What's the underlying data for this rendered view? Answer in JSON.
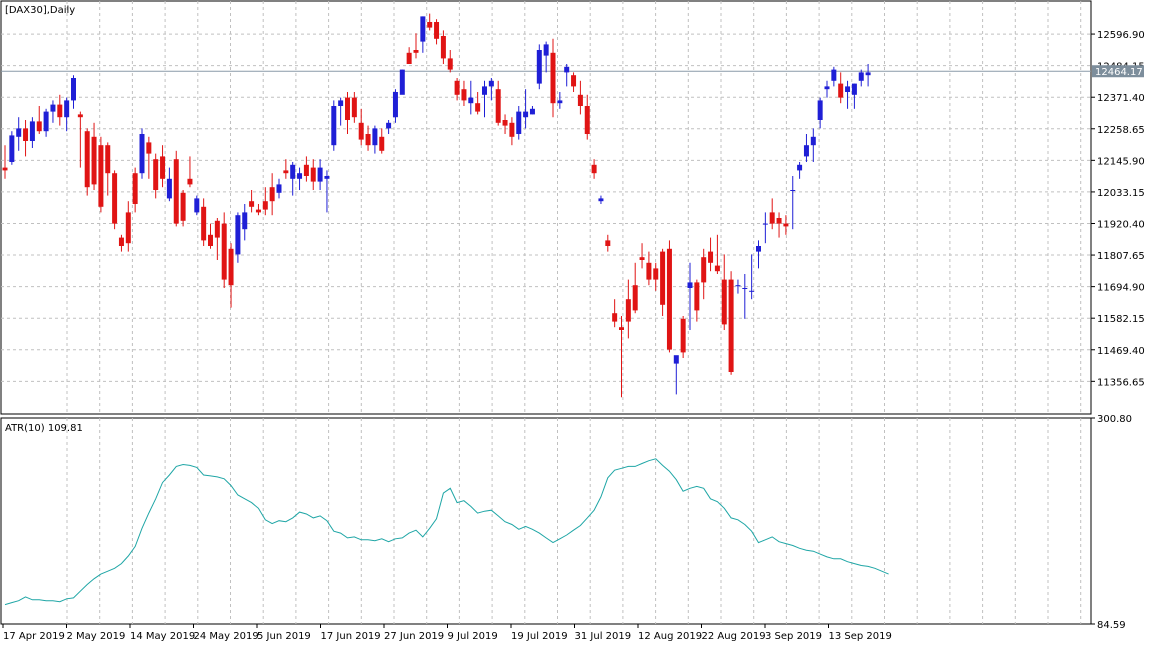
{
  "chart_data": [
    {
      "type": "candlestick",
      "title": "[DAX30],Daily",
      "up_color": "#1f1fd6",
      "down_color": "#e01414",
      "ylim": [
        11240,
        12715
      ],
      "y_ticks": [
        "12596.90",
        "12371.40",
        "12258.65",
        "12145.90",
        "12033.15",
        "11920.40",
        "11807.65",
        "11694.90",
        "11582.15",
        "11469.40",
        "11356.65"
      ],
      "partial_tick": "12484.15",
      "current_price": "12464.17",
      "current_price_value": 12464.17,
      "candles": [
        [
          12120,
          12200,
          12080,
          12110
        ],
        [
          12140,
          12250,
          12130,
          12235
        ],
        [
          12230,
          12300,
          12180,
          12260
        ],
        [
          12260,
          12290,
          12160,
          12215
        ],
        [
          12215,
          12300,
          12190,
          12285
        ],
        [
          12285,
          12340,
          12240,
          12250
        ],
        [
          12250,
          12330,
          12230,
          12320
        ],
        [
          12320,
          12360,
          12280,
          12345
        ],
        [
          12345,
          12380,
          12270,
          12300
        ],
        [
          12300,
          12370,
          12250,
          12360
        ],
        [
          12360,
          12450,
          12330,
          12440
        ],
        [
          12310,
          12320,
          12120,
          12300
        ],
        [
          12250,
          12260,
          12020,
          12050
        ],
        [
          12230,
          12280,
          12040,
          12060
        ],
        [
          12200,
          12230,
          11960,
          11980
        ],
        [
          12200,
          12210,
          12020,
          12100
        ],
        [
          12100,
          12110,
          11900,
          11920
        ],
        [
          11870,
          11880,
          11820,
          11840
        ],
        [
          11960,
          12000,
          11820,
          11850
        ],
        [
          12100,
          12120,
          11960,
          11990
        ],
        [
          12100,
          12260,
          12080,
          12240
        ],
        [
          12210,
          12230,
          12080,
          12170
        ],
        [
          12150,
          12170,
          12010,
          12040
        ],
        [
          12160,
          12200,
          12050,
          12080
        ],
        [
          12010,
          12120,
          12000,
          12080
        ],
        [
          12150,
          12180,
          11910,
          11920
        ],
        [
          12030,
          12040,
          11910,
          11930
        ],
        [
          12080,
          12160,
          12050,
          12060
        ],
        [
          11960,
          12020,
          11950,
          12010
        ],
        [
          11980,
          12010,
          11840,
          11860
        ],
        [
          11880,
          11920,
          11830,
          11840
        ],
        [
          11930,
          11940,
          11790,
          11870
        ],
        [
          11920,
          11960,
          11690,
          11720
        ],
        [
          11830,
          11850,
          11620,
          11700
        ],
        [
          11810,
          11960,
          11780,
          11950
        ],
        [
          11900,
          11990,
          11860,
          11960
        ],
        [
          12000,
          12040,
          11960,
          11980
        ],
        [
          11970,
          11990,
          11950,
          11960
        ],
        [
          12000,
          12050,
          11950,
          11970
        ],
        [
          12050,
          12100,
          11950,
          12000
        ],
        [
          12030,
          12080,
          12010,
          12060
        ],
        [
          12110,
          12150,
          12080,
          12100
        ],
        [
          12080,
          12140,
          12020,
          12130
        ],
        [
          12080,
          12120,
          12040,
          12100
        ],
        [
          12130,
          12160,
          12070,
          12090
        ],
        [
          12120,
          12150,
          12040,
          12070
        ],
        [
          12070,
          12150,
          12040,
          12120
        ],
        [
          12080,
          12110,
          11960,
          12090
        ],
        [
          12200,
          12360,
          12180,
          12340
        ],
        [
          12340,
          12370,
          12270,
          12360
        ],
        [
          12370,
          12390,
          12240,
          12290
        ],
        [
          12370,
          12390,
          12280,
          12300
        ],
        [
          12280,
          12330,
          12200,
          12220
        ],
        [
          12240,
          12270,
          12180,
          12200
        ],
        [
          12200,
          12270,
          12170,
          12260
        ],
        [
          12230,
          12260,
          12170,
          12180
        ],
        [
          12260,
          12290,
          12240,
          12280
        ],
        [
          12300,
          12400,
          12280,
          12390
        ],
        [
          12380,
          12470,
          12460,
          12470
        ],
        [
          12530,
          12550,
          12490,
          12490
        ],
        [
          12540,
          12600,
          12510,
          12530
        ],
        [
          12570,
          12660,
          12530,
          12660
        ],
        [
          12640,
          12670,
          12610,
          12620
        ],
        [
          12640,
          12650,
          12560,
          12580
        ],
        [
          12590,
          12610,
          12490,
          12510
        ],
        [
          12510,
          12540,
          12460,
          12470
        ],
        [
          12430,
          12440,
          12360,
          12380
        ],
        [
          12400,
          12430,
          12340,
          12360
        ],
        [
          12350,
          12430,
          12310,
          12370
        ],
        [
          12350,
          12390,
          12310,
          12320
        ],
        [
          12380,
          12430,
          12300,
          12410
        ],
        [
          12410,
          12440,
          12360,
          12430
        ],
        [
          12400,
          12430,
          12270,
          12280
        ],
        [
          12290,
          12310,
          12240,
          12270
        ],
        [
          12280,
          12300,
          12200,
          12230
        ],
        [
          12240,
          12340,
          12220,
          12320
        ],
        [
          12300,
          12400,
          12260,
          12320
        ],
        [
          12310,
          12340,
          12310,
          12330
        ],
        [
          12420,
          12560,
          12400,
          12540
        ],
        [
          12520,
          12570,
          12460,
          12560
        ],
        [
          12530,
          12580,
          12300,
          12350
        ],
        [
          12350,
          12390,
          12330,
          12360
        ],
        [
          12460,
          12490,
          12410,
          12480
        ],
        [
          12450,
          12460,
          12390,
          12410
        ],
        [
          12380,
          12430,
          12310,
          12340
        ],
        [
          12340,
          12380,
          12220,
          12240
        ],
        [
          12130,
          12150,
          12080,
          12100
        ],
        [
          12000,
          12020,
          11990,
          12010
        ],
        [
          11860,
          11880,
          11820,
          11840
        ],
        [
          11600,
          11650,
          11550,
          11570
        ],
        [
          11550,
          11590,
          11300,
          11540
        ],
        [
          11650,
          11720,
          11510,
          11570
        ],
        [
          11700,
          11780,
          11600,
          11610
        ],
        [
          11800,
          11850,
          11760,
          11790
        ],
        [
          11780,
          11820,
          11700,
          11720
        ],
        [
          11760,
          11780,
          11680,
          11720
        ],
        [
          11820,
          11830,
          11590,
          11630
        ],
        [
          11830,
          11860,
          11460,
          11470
        ],
        [
          11420,
          11430,
          11310,
          11450
        ],
        [
          11580,
          11590,
          11440,
          11460
        ],
        [
          11690,
          11780,
          11540,
          11710
        ],
        [
          11710,
          11720,
          11570,
          11610
        ],
        [
          11800,
          11830,
          11650,
          11710
        ],
        [
          11820,
          11870,
          11750,
          11780
        ],
        [
          11770,
          11880,
          11740,
          11750
        ],
        [
          11720,
          11810,
          11540,
          11560
        ],
        [
          11720,
          11750,
          11380,
          11390
        ],
        [
          11700,
          11720,
          11670,
          11700
        ],
        [
          11690,
          11740,
          11580,
          11690
        ],
        [
          11680,
          11810,
          11650,
          11680
        ],
        [
          11820,
          11860,
          11760,
          11840
        ],
        [
          11920,
          11960,
          11850,
          11920
        ],
        [
          11960,
          12010,
          11900,
          11920
        ],
        [
          11940,
          11960,
          11870,
          11920
        ],
        [
          11920,
          11950,
          11880,
          11910
        ],
        [
          12040,
          12090,
          11900,
          12040
        ],
        [
          12110,
          12140,
          12080,
          12130
        ],
        [
          12160,
          12240,
          12140,
          12200
        ],
        [
          12200,
          12260,
          12140,
          12230
        ],
        [
          12290,
          12370,
          12260,
          12360
        ],
        [
          12400,
          12430,
          12370,
          12410
        ],
        [
          12430,
          12480,
          12410,
          12470
        ],
        [
          12420,
          12460,
          12350,
          12370
        ],
        [
          12390,
          12430,
          12330,
          12410
        ],
        [
          12380,
          12420,
          12330,
          12420
        ],
        [
          12430,
          12470,
          12410,
          12460
        ],
        [
          12450,
          12490,
          12410,
          12460
        ]
      ]
    },
    {
      "type": "line",
      "title": "ATR(10) 109.81",
      "color": "#1fa6a6",
      "ylim": [
        84.59,
        300.8
      ],
      "y_ticks": [
        "300.80",
        "84.59"
      ],
      "values": [
        105,
        107,
        109,
        113,
        110,
        110,
        109,
        109,
        108,
        111,
        112,
        119,
        126,
        132,
        137,
        140,
        143,
        148,
        156,
        166,
        185,
        201,
        216,
        233,
        241,
        250,
        252,
        251,
        249,
        241,
        240,
        239,
        237,
        230,
        220,
        216,
        212,
        206,
        194,
        190,
        193,
        192,
        196,
        202,
        200,
        196,
        198,
        193,
        182,
        180,
        175,
        176,
        173,
        173,
        172,
        174,
        171,
        174,
        175,
        180,
        183,
        176,
        185,
        195,
        222,
        227,
        212,
        214,
        208,
        201,
        203,
        204,
        198,
        192,
        189,
        184,
        187,
        184,
        180,
        175,
        170,
        174,
        178,
        183,
        188,
        196,
        204,
        218,
        238,
        246,
        248,
        250,
        250,
        253,
        256,
        258,
        251,
        245,
        236,
        224,
        227,
        229,
        227,
        216,
        213,
        206,
        196,
        194,
        189,
        182,
        170,
        173,
        176,
        171,
        169,
        167,
        164,
        162,
        161,
        158,
        155,
        153,
        153,
        150,
        148,
        146,
        145,
        143,
        140,
        137
      ]
    },
    {
      "type": "x-axis",
      "labels": [
        "17 Apr 2019",
        "2 May 2019",
        "14 May 2019",
        "24 May 2019",
        "5 Jun 2019",
        "17 Jun 2019",
        "27 Jun 2019",
        "9 Jul 2019",
        "19 Jul 2019",
        "31 Jul 2019",
        "12 Aug 2019",
        "22 Aug 2019",
        "3 Sep 2019",
        "13 Sep 2019"
      ]
    }
  ]
}
